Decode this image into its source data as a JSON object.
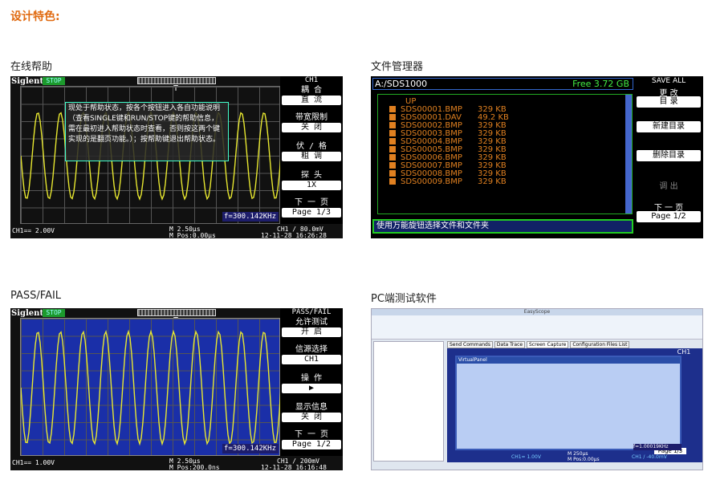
{
  "page": {
    "title": "设计特色:"
  },
  "captions": {
    "help": "在线帮助",
    "filemgr": "文件管理器",
    "passfail": "PASS/FAIL",
    "pc": "PC端测试软件"
  },
  "help_scope": {
    "brand": "Siglent",
    "run_state": "STOP",
    "trigger_mark": "T",
    "menu_header": "CH1",
    "menu": [
      {
        "label": "耦 合",
        "value": "直 流"
      },
      {
        "label": "带宽限制",
        "value": "关 闭"
      },
      {
        "label": "伏 / 格",
        "value": "粗 调"
      },
      {
        "label": "探 头",
        "value": "1X"
      },
      {
        "label": "下 一 页",
        "value": "Page 1/3"
      }
    ],
    "help_text": "现处于帮助状态，按各个按钮进入各自功能说明（查看SINGLE键和RUN/STOP键的帮助信息，需在最初进入帮助状态时查看，否则按这两个键实现的是翻页功能。）；按帮助键退出帮助状态。",
    "freq": "f=300.142KHz",
    "ch1": "CH1== 2.00V",
    "timebase": "M 2.50μs",
    "mpos": "M Pos:0.00μs",
    "trigger": "CH1 / 80.0mV",
    "datetime": "12-11-28 16:26:28"
  },
  "filemgr": {
    "path": "A:/SDS1000",
    "free": "Free  3.72 GB",
    "up": "UP",
    "files": [
      {
        "name": "SDS00001.BMP",
        "size": "329 KB"
      },
      {
        "name": "SDS00001.DAV",
        "size": "49.2 KB"
      },
      {
        "name": "SDS00002.BMP",
        "size": "329 KB"
      },
      {
        "name": "SDS00003.BMP",
        "size": "329 KB"
      },
      {
        "name": "SDS00004.BMP",
        "size": "329 KB"
      },
      {
        "name": "SDS00005.BMP",
        "size": "329 KB"
      },
      {
        "name": "SDS00006.BMP",
        "size": "329 KB"
      },
      {
        "name": "SDS00007.BMP",
        "size": "329 KB"
      },
      {
        "name": "SDS00008.BMP",
        "size": "329 KB"
      },
      {
        "name": "SDS00009.BMP",
        "size": "329 KB"
      }
    ],
    "hint": "使用万能旋钮选择文件和文件夹",
    "menu": {
      "header": "SAVE ALL",
      "change": "更 改",
      "dir": "目 录",
      "new_dir": "新建目录",
      "del_dir": "删除目录",
      "recall": "调 出",
      "next": "下 一 页",
      "page": "Page 1/2"
    }
  },
  "pass_scope": {
    "brand": "Siglent",
    "run_state": "STOP",
    "trigger_mark": "T",
    "menu_header": "PASS/FAIL",
    "menu": [
      {
        "label": "允许测试",
        "value": "开 启"
      },
      {
        "label": "信源选择",
        "value": "CH1"
      },
      {
        "label": "操 作",
        "value": "▶"
      },
      {
        "label": "显示信息",
        "value": "关 闭"
      },
      {
        "label": "下 一 页",
        "value": "Page 1/2"
      }
    ],
    "freq": "f=300.142KHz",
    "ch1": "CH1== 1.00V",
    "timebase": "M 2.50μs",
    "mpos": "M Pos:200.0ns",
    "trigger": "CH1 / 200mV",
    "datetime": "12-11-28 16:16:48"
  },
  "pc_app": {
    "window_title": "EasyScope",
    "tabs": [
      "Send Commands",
      "Data Trace",
      "Screen Capture",
      "Configuration Files List"
    ],
    "panel_title": "VirtualPanel",
    "freq": "f=1.00019KHz",
    "page": "Page 1/3",
    "ch1": "CH1= 1.00V",
    "timebase": "M 250μs",
    "mpos": "M Pos:0.00μs",
    "trigger": "CH1 / -40.0mV",
    "menu_header": "CH1",
    "colors": {
      "panel_bg": "#b9cdf3",
      "scope_bg": "#1d2f8c"
    }
  }
}
